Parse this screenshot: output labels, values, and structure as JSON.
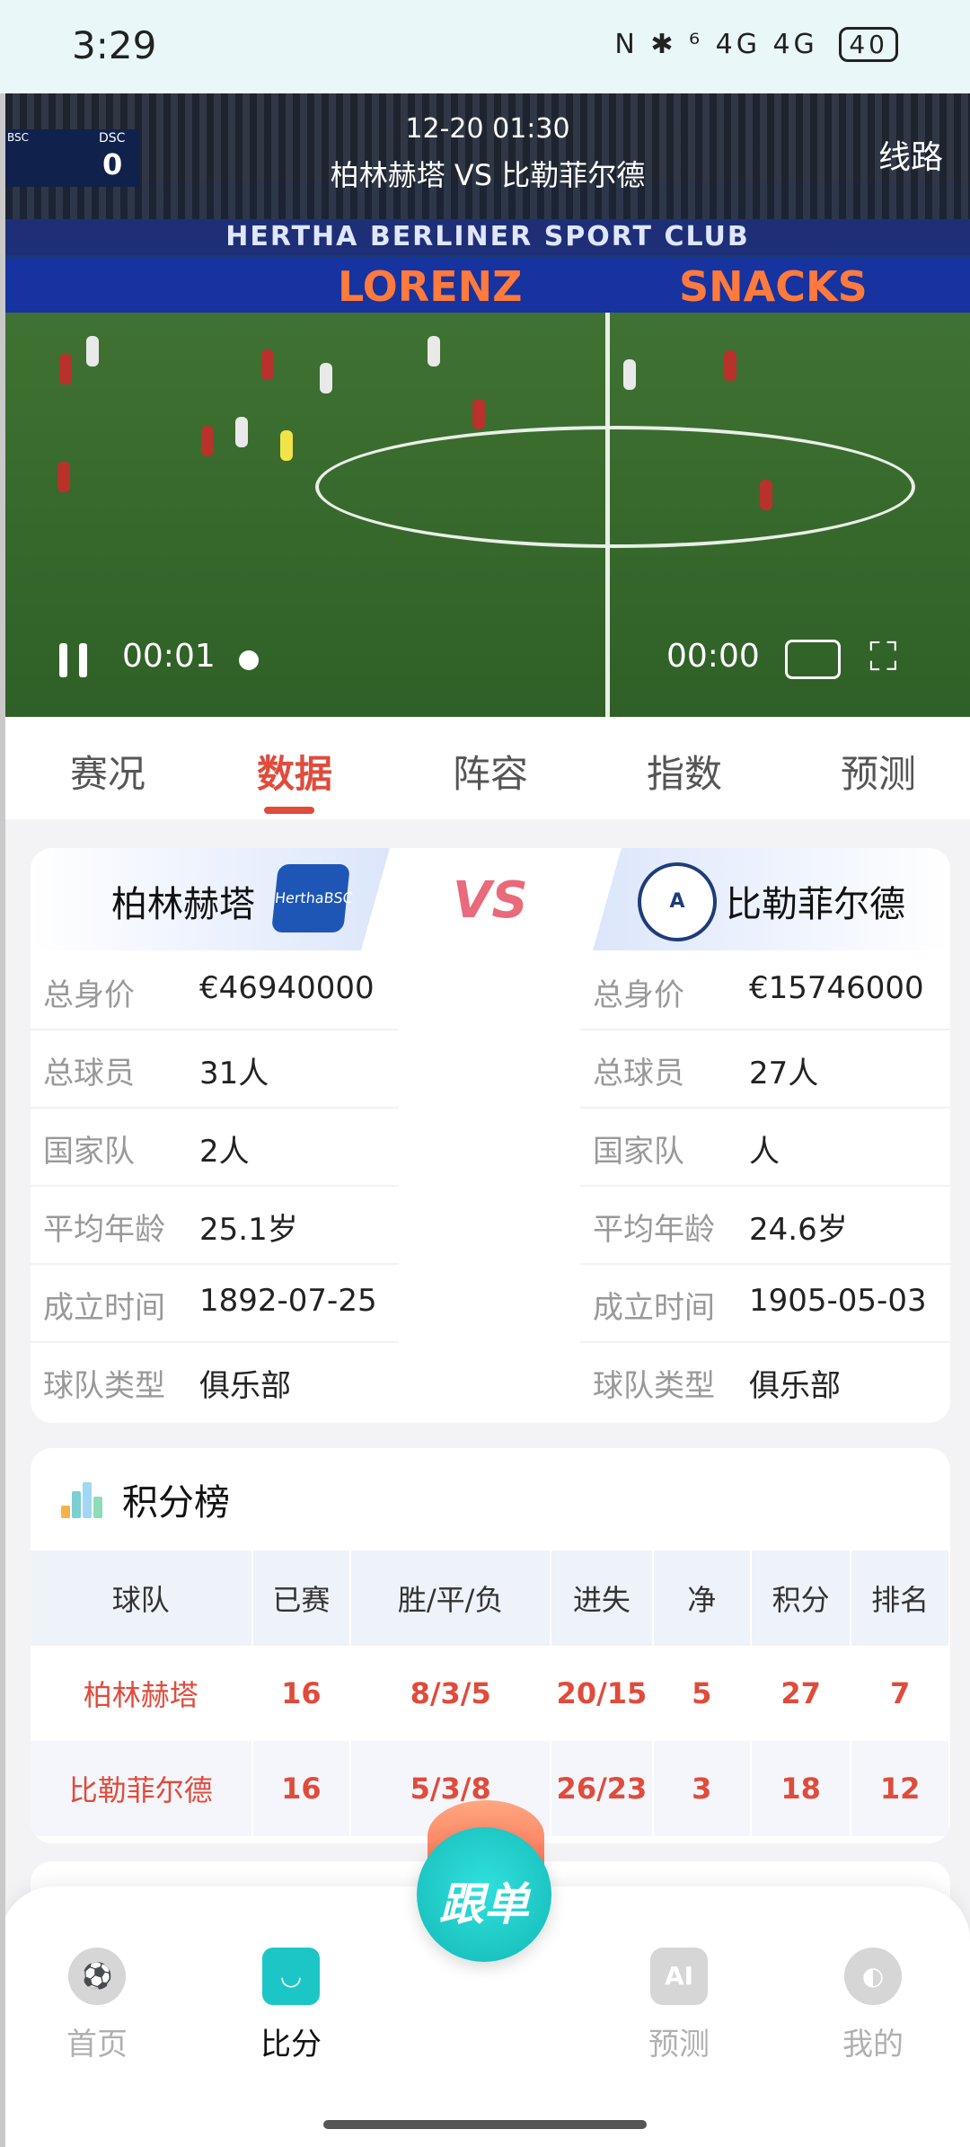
{
  "status_bar": {
    "time": "3:29",
    "icons": "N ✱ ⁶ 4G 4G",
    "battery": "40"
  },
  "video": {
    "date": "12-20 01:30",
    "title": "柏林赫塔 VS 比勒菲尔德",
    "route_label": "线路",
    "scorebug": {
      "home_code": "BSC",
      "away_code": "DSC",
      "away_score": "0"
    },
    "banner_top": "HERTHA BERLINER SPORT CLUB",
    "banner_ad": [
      "LORENZ",
      "SNACKS"
    ],
    "time_current": "00:01",
    "time_total": "00:00"
  },
  "tabs": [
    "赛况",
    "数据",
    "阵容",
    "指数",
    "预测"
  ],
  "active_tab": "数据",
  "teams": {
    "vs_label": "VS",
    "home": {
      "name": "柏林赫塔",
      "logo_text": "HerthaBSC",
      "stats": [
        {
          "label": "总身价",
          "value": "€46940000"
        },
        {
          "label": "总球员",
          "value": "31人"
        },
        {
          "label": "国家队",
          "value": "2人"
        },
        {
          "label": "平均年龄",
          "value": "25.1岁"
        },
        {
          "label": "成立时间",
          "value": "1892-07-25"
        },
        {
          "label": "球队类型",
          "value": "俱乐部"
        }
      ]
    },
    "away": {
      "name": "比勒菲尔德",
      "logo_text": "A",
      "stats": [
        {
          "label": "总身价",
          "value": "€15746000"
        },
        {
          "label": "总球员",
          "value": "27人"
        },
        {
          "label": "国家队",
          "value": "人"
        },
        {
          "label": "平均年龄",
          "value": "24.6岁"
        },
        {
          "label": "成立时间",
          "value": "1905-05-03"
        },
        {
          "label": "球队类型",
          "value": "俱乐部"
        }
      ]
    }
  },
  "standings": {
    "title": "积分榜",
    "headers": [
      "球队",
      "已赛",
      "胜/平/负",
      "进失",
      "净",
      "积分",
      "排名"
    ],
    "rows": [
      [
        "柏林赫塔",
        "16",
        "8/3/5",
        "20/15",
        "5",
        "27",
        "7"
      ],
      [
        "比勒菲尔德",
        "16",
        "5/3/8",
        "26/23",
        "3",
        "18",
        "12"
      ]
    ]
  },
  "bottom_nav": {
    "items": [
      {
        "label": "首页",
        "icon": "soccer-ball-icon"
      },
      {
        "label": "比分",
        "icon": "score-icon"
      },
      {
        "label": "预测",
        "icon": "ai-icon",
        "icon_text": "AI"
      },
      {
        "label": "我的",
        "icon": "profile-icon"
      }
    ],
    "center_button": "跟单",
    "active": "比分"
  },
  "colors": {
    "accent": "#e04b3c",
    "teal": "#1dc6c6",
    "vs": "#e96a7a"
  }
}
